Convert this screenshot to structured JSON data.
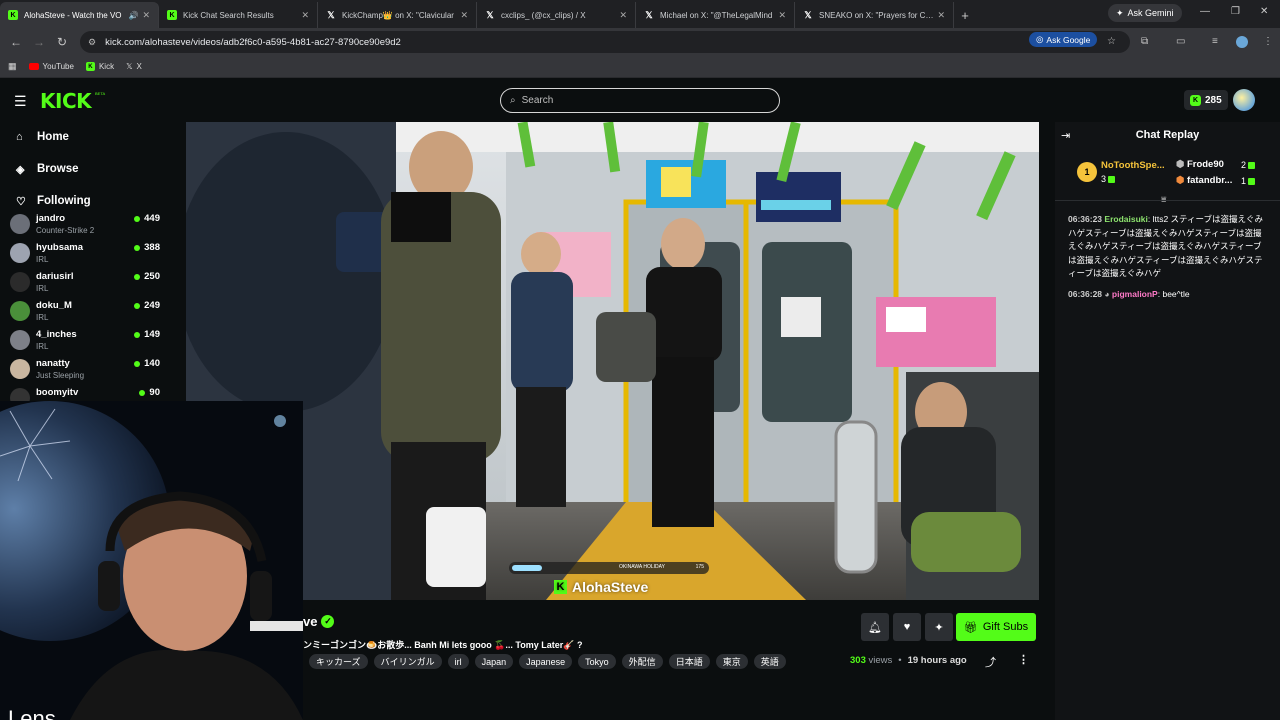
{
  "browser": {
    "tabs": [
      {
        "title": "AlohaSteve - Watch the VO",
        "favicon": "kick",
        "active": true
      },
      {
        "title": "Kick Chat Search Results",
        "favicon": "kick",
        "active": false
      },
      {
        "title": "KickChamp👑 on X: \"Clavicular",
        "favicon": "x",
        "active": false
      },
      {
        "title": "cxclips_ (@cx_clips) / X",
        "favicon": "x",
        "active": false
      },
      {
        "title": "Michael on X: \"@TheLegalMind",
        "favicon": "x",
        "active": false
      },
      {
        "title": "SNEAKO on X: \"Prayers for Clav",
        "favicon": "x",
        "active": false
      }
    ],
    "new_tab_label": "+",
    "ask_gemini": "Ask Gemini",
    "url": "kick.com/alohasteve/videos/adb2f6c0-a595-4b81-ac27-8790ce90e9d2",
    "ask_google": "Ask Google",
    "bookmarks": [
      {
        "label": "YouTube"
      },
      {
        "label": "Kick"
      },
      {
        "label": "X"
      }
    ]
  },
  "kick": {
    "logo": "KICK",
    "beta": "BETA",
    "search_placeholder": "Search",
    "points": "285",
    "accent": "#53fc18"
  },
  "sidebar": {
    "nav": [
      {
        "label": "Home",
        "icon": "home-icon"
      },
      {
        "label": "Browse",
        "icon": "compass-icon"
      },
      {
        "label": "Following",
        "icon": "heart-icon"
      }
    ],
    "channels": [
      {
        "name": "jandro",
        "category": "Counter-Strike 2",
        "viewers": "449"
      },
      {
        "name": "hyubsama",
        "category": "IRL",
        "viewers": "388"
      },
      {
        "name": "dariusirl",
        "category": "IRL",
        "viewers": "250"
      },
      {
        "name": "doku_M",
        "category": "IRL",
        "viewers": "249"
      },
      {
        "name": "4_inches",
        "category": "IRL",
        "viewers": "149"
      },
      {
        "name": "nanatty",
        "category": "Just Sleeping",
        "viewers": "140"
      },
      {
        "name": "boomyitv",
        "category": "",
        "viewers": "90"
      }
    ]
  },
  "video": {
    "watermark": "AlohaSteve",
    "overlay_label": "OKINAWA HOLIDAY",
    "overlay_number": "175",
    "title_fragment": "ve",
    "description": "ンミーゴンゴン🍮お散歩... Banh Mi lets gooo 🍒... Tomy Later🎸 ?",
    "tags": [
      "キッカーズ",
      "バイリンガル",
      "irl",
      "Japan",
      "Japanese",
      "Tokyo",
      "外配信",
      "日本語",
      "東京",
      "英語"
    ],
    "views": "303",
    "views_label": "views",
    "separator": "•",
    "posted": "19 hours ago",
    "gift_subs": "Gift Subs"
  },
  "chat": {
    "title": "Chat Replay",
    "gifters": [
      {
        "rank": "1",
        "name": "NoToothSpe...",
        "count": "3"
      },
      {
        "name": "Frode90",
        "count": "2"
      },
      {
        "name": "fatandbr...",
        "count": "1"
      }
    ],
    "messages": [
      {
        "time": "06:36:23",
        "user": "Erodaisuki",
        "user_color": "#8de36e",
        "text": "ltts2 スティーブは盗撮えぐみハゲスティーブは盗撮えぐみハゲスティーブは盗撮えぐみハゲスティーブは盗撮えぐみハゲスティーブは盗撮えぐみハゲスティーブは盗撮えぐみハゲスティーブは盗撮えぐみハゲ"
      },
      {
        "time": "06:36:28",
        "user": "pigmalionP",
        "user_color": "#ff7ac8",
        "text": "bee^tle"
      }
    ]
  },
  "webcam": {
    "caption": "Lens"
  }
}
